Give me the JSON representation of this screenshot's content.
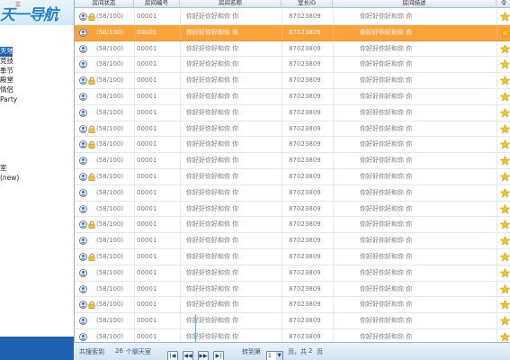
{
  "logo": {
    "text": "天一导航",
    "badge": "三"
  },
  "nav": {
    "items": [
      {
        "label": "",
        "active": false
      },
      {
        "label": "",
        "active": false
      },
      {
        "label": "天地",
        "active": true
      },
      {
        "label": "竞技",
        "active": false
      },
      {
        "label": "季节",
        "active": false
      },
      {
        "label": "殿堂",
        "active": false
      },
      {
        "label": "情侣",
        "active": false
      },
      {
        "label": "Party",
        "active": false
      },
      {
        "label": "",
        "active": false
      },
      {
        "label": "",
        "active": false
      },
      {
        "label": "",
        "active": false
      },
      {
        "label": "",
        "active": false
      },
      {
        "label": "",
        "active": false
      },
      {
        "label": "",
        "active": false
      },
      {
        "label": "室",
        "active": false
      },
      {
        "label": "(new)",
        "active": false
      }
    ]
  },
  "table": {
    "headers": [
      "房间状态",
      "房间编号",
      "房间名称",
      "室长ID",
      "房间描述",
      "令"
    ],
    "rows": [
      {
        "status": "(58/100)",
        "number": "00001",
        "name": "你好好你好和你 你",
        "owner": "87023809",
        "topic": "你好好你好和你 你",
        "lock": true,
        "selected": false
      },
      {
        "status": "(58/100)",
        "number": "00001",
        "name": "你好好你好和你 你",
        "owner": "87023809",
        "topic": "你好好你好和你 你",
        "lock": false,
        "selected": true
      },
      {
        "status": "(58/100)",
        "number": "00001",
        "name": "你好好你好和你 你",
        "owner": "87023809",
        "topic": "你好好你好和你 你",
        "lock": false,
        "selected": false
      },
      {
        "status": "(58/100)",
        "number": "00001",
        "name": "你好好你好和你 你",
        "owner": "87023809",
        "topic": "你好好你好和你 你",
        "lock": false,
        "selected": false
      },
      {
        "status": "(58/100)",
        "number": "00001",
        "name": "你好好你好和你 你",
        "owner": "87023809",
        "topic": "你好好你好和你 你",
        "lock": true,
        "selected": false
      },
      {
        "status": "(58/100)",
        "number": "00001",
        "name": "你好好你好和你 你",
        "owner": "87023809",
        "topic": "你好好你好和你 你",
        "lock": false,
        "selected": false
      },
      {
        "status": "(58/100)",
        "number": "00001",
        "name": "你好好你好和你 你",
        "owner": "87023809",
        "topic": "你好好你好和你 你",
        "lock": false,
        "selected": false
      },
      {
        "status": "(58/100)",
        "number": "00001",
        "name": "你好好你好和你 你",
        "owner": "87023809",
        "topic": "你好好你好和你 你",
        "lock": true,
        "selected": false
      },
      {
        "status": "(58/100)",
        "number": "00001",
        "name": "你好好你好和你 你",
        "owner": "87023809",
        "topic": "你好好你好和你 你",
        "lock": true,
        "selected": false
      },
      {
        "status": "(58/100)",
        "number": "00001",
        "name": "你好好你好和你 你",
        "owner": "87023809",
        "topic": "你好好你好和你 你",
        "lock": false,
        "selected": false
      },
      {
        "status": "(58/100)",
        "number": "00001",
        "name": "你好好你好和你 你",
        "owner": "87023809",
        "topic": "你好好你好和你 你",
        "lock": true,
        "selected": false
      },
      {
        "status": "(58/100)",
        "number": "00001",
        "name": "你好好你好和你 你",
        "owner": "87023809",
        "topic": "你好好你好和你 你",
        "lock": false,
        "selected": false
      },
      {
        "status": "(58/100)",
        "number": "00001",
        "name": "你好好你好和你 你",
        "owner": "87023809",
        "topic": "你好好你好和你 你",
        "lock": false,
        "selected": false
      },
      {
        "status": "(58/100)",
        "number": "00001",
        "name": "你好好你好和你 你",
        "owner": "87023809",
        "topic": "你好好你好和你 你",
        "lock": true,
        "selected": false
      },
      {
        "status": "(58/100)",
        "number": "00001",
        "name": "你好好你好和你 你",
        "owner": "87023809",
        "topic": "你好好你好和你 你",
        "lock": false,
        "selected": false
      },
      {
        "status": "(58/100)",
        "number": "00001",
        "name": "你好好你好和你 你",
        "owner": "87023809",
        "topic": "你好好你好和你 你",
        "lock": true,
        "selected": false
      },
      {
        "status": "(58/100)",
        "number": "00001",
        "name": "你好好你好和你 你",
        "owner": "87023809",
        "topic": "你好好你好和你 你",
        "lock": false,
        "selected": false
      },
      {
        "status": "(58/100)",
        "number": "00001",
        "name": "你好好你好和你 你",
        "owner": "87023809",
        "topic": "你好好你好和你 你",
        "lock": false,
        "selected": false
      },
      {
        "status": "(58/100)",
        "number": "00001",
        "name": "你好好你好和你 你",
        "owner": "87023809",
        "topic": "你好好你好和你 你",
        "lock": true,
        "selected": false
      },
      {
        "status": "(58/100)",
        "number": "00001",
        "name": "你好好你好和你 你",
        "owner": "87023809",
        "topic": "你好好你好和你 你",
        "lock": false,
        "selected": false
      },
      {
        "status": "(58/100)",
        "number": "00001",
        "name": "你好好你好和你 你",
        "owner": "87023809",
        "topic": "你好好你好和你 你",
        "lock": false,
        "selected": false
      }
    ]
  },
  "pager": {
    "search_prefix": "共搜索到",
    "count": "26",
    "search_suffix": "个聊天室",
    "first_btn": "|◀",
    "prev_btn": "◀◀",
    "next_btn": "▶▶",
    "last_btn": "▶|",
    "goto_label": "转到第",
    "page_value": "1",
    "page_suffix": "页，共",
    "total_pages": "2",
    "total_suffix": "页"
  },
  "colors": {
    "selected_row": "#f9a33a",
    "nav_active": "#1b5fb8",
    "header_bg": "#d9e4f0",
    "star": "#f5c518"
  }
}
